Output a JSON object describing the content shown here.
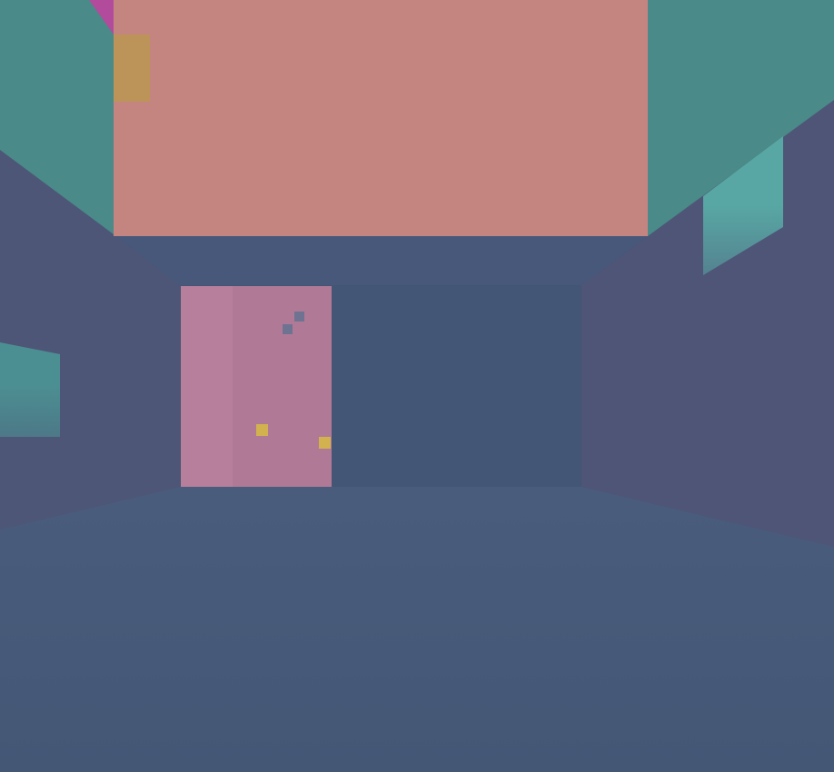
{
  "scene": {
    "kind": "first-person 3D room view",
    "hud_text": []
  },
  "palette": {
    "floor": "#445775",
    "floor_far": "#4a5c7c",
    "back_wall": "#435675",
    "left_wall": "#4e5677",
    "right_wall": "#4f5577",
    "ceiling_strip": "#47587a",
    "ceiling_panel": "#c4847f",
    "upper_wall_teal": "#4a8a88",
    "doorway_pink": "#b07a96",
    "window_teal": "#4c8f92",
    "window_teal_light": "#58a7a4",
    "accent_magenta": "#b24b9b",
    "accent_gold": "#b99a4c",
    "marker_yellow": "#d1b24e",
    "marker_gray": "#6f7392"
  },
  "objects": [
    {
      "name": "ceiling-panel",
      "color_key": "ceiling_panel"
    },
    {
      "name": "upper-left-wall",
      "color_key": "upper_wall_teal"
    },
    {
      "name": "upper-right-wall",
      "color_key": "upper_wall_teal"
    },
    {
      "name": "pink-doorway",
      "color_key": "doorway_pink"
    },
    {
      "name": "left-window",
      "color_key": "window_teal"
    },
    {
      "name": "right-window",
      "color_key": "window_teal_light"
    },
    {
      "name": "yellow-marker",
      "color_key": "marker_yellow",
      "count": 2
    },
    {
      "name": "gray-marker",
      "color_key": "marker_gray",
      "count": 2
    }
  ]
}
